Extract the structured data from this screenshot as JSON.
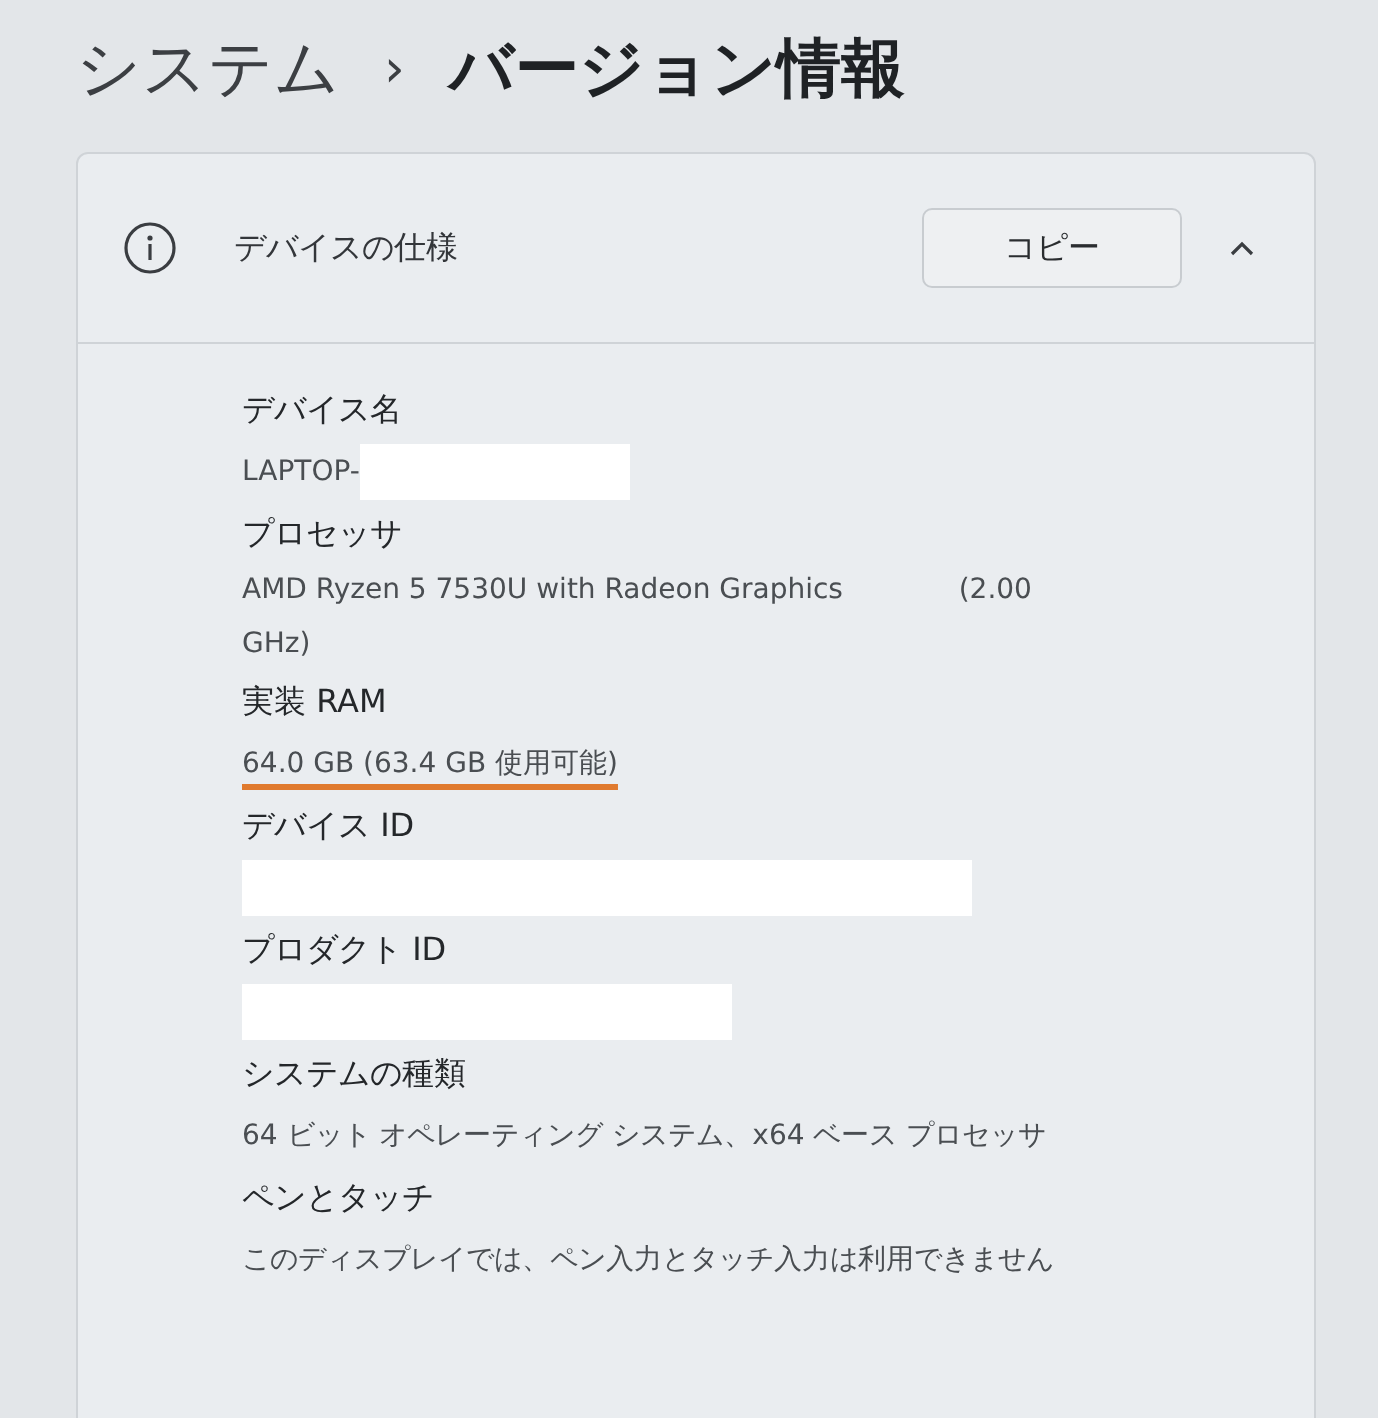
{
  "breadcrumb": {
    "parent": "システム",
    "separator": "›",
    "current": "バージョン情報"
  },
  "section": {
    "title": "デバイスの仕様",
    "copy_button": "コピー",
    "expanded": true,
    "specs": [
      {
        "label": "デバイス名",
        "value": "LAPTOP-",
        "redacted": true
      },
      {
        "label": "プロセッサ",
        "value": "AMD Ryzen 5 7530U with Radeon Graphics             (2.00 GHz)"
      },
      {
        "label": "実装 RAM",
        "value": "64.0 GB (63.4 GB 使用可能)",
        "underlined": true
      },
      {
        "label": "デバイス ID",
        "redacted": true
      },
      {
        "label": "プロダクト ID",
        "redacted": true
      },
      {
        "label": "システムの種類",
        "value": "64 ビット オペレーティング システム、x64 ベース プロセッサ"
      },
      {
        "label": "ペンとタッチ",
        "value": "このディスプレイでは、ペン入力とタッチ入力は利用できません"
      }
    ]
  }
}
